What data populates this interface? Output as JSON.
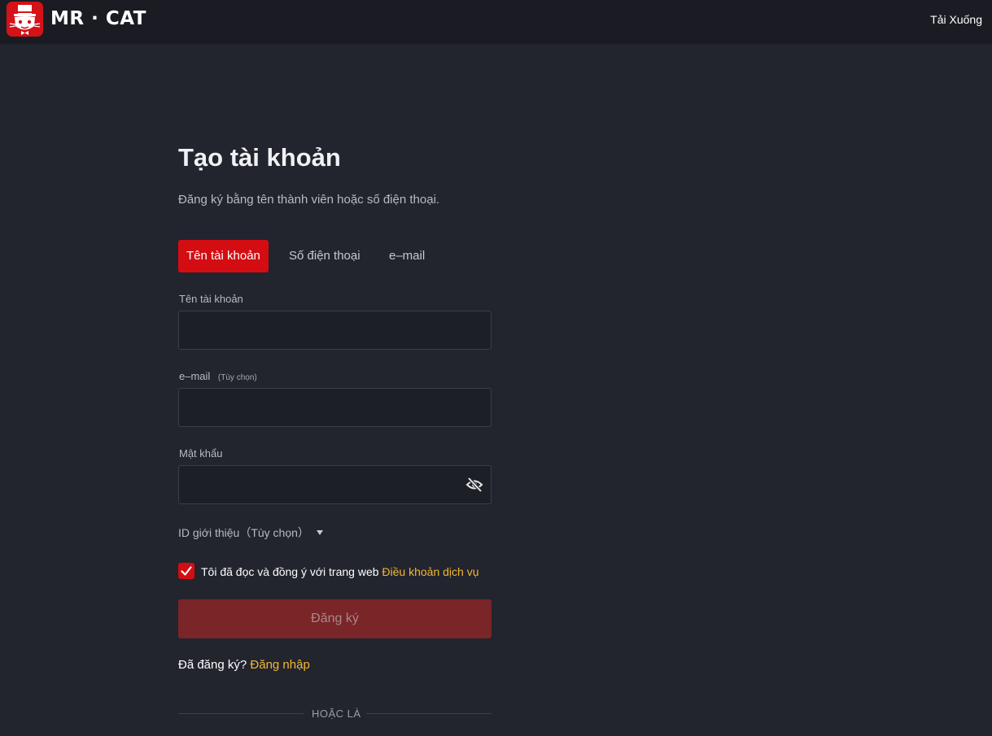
{
  "header": {
    "brand": "MR · CAT",
    "download_label": "Tải Xuống"
  },
  "form": {
    "title": "Tạo tài khoản",
    "subtitle": "Đăng ký bằng tên thành viên hoặc số điện thoại.",
    "tabs": [
      {
        "label": "Tên tài khoản",
        "active": true
      },
      {
        "label": "Số điện thoại",
        "active": false
      },
      {
        "label": "e–mail",
        "active": false
      }
    ],
    "fields": {
      "username": {
        "label": "Tên tài khoản",
        "value": ""
      },
      "email": {
        "label": "e–mail",
        "optional": "(Tùy chọn)",
        "value": ""
      },
      "password": {
        "label": "Mật khẩu",
        "value": ""
      }
    },
    "referral_label": "ID giới thiệu（Tùy chọn）",
    "agree_checked": true,
    "agree_text": "Tôi đã đọc và đồng ý với trang web",
    "terms_link": "Điều khoản dịch vụ",
    "submit_label": "Đăng ký",
    "already_text": "Đã đăng ký?",
    "login_link": "Đăng nhập",
    "divider_text": "HOẶC LÀ"
  },
  "colors": {
    "background": "#22242e",
    "accent": "#d40d12",
    "link": "#f3b732",
    "submit_disabled": "#7a2528"
  },
  "icons": {
    "logo": "mr-cat-logo-icon",
    "password_toggle": "eye-slash-icon",
    "checkbox": "checkmark-icon",
    "dropdown": "caret-down-icon"
  }
}
